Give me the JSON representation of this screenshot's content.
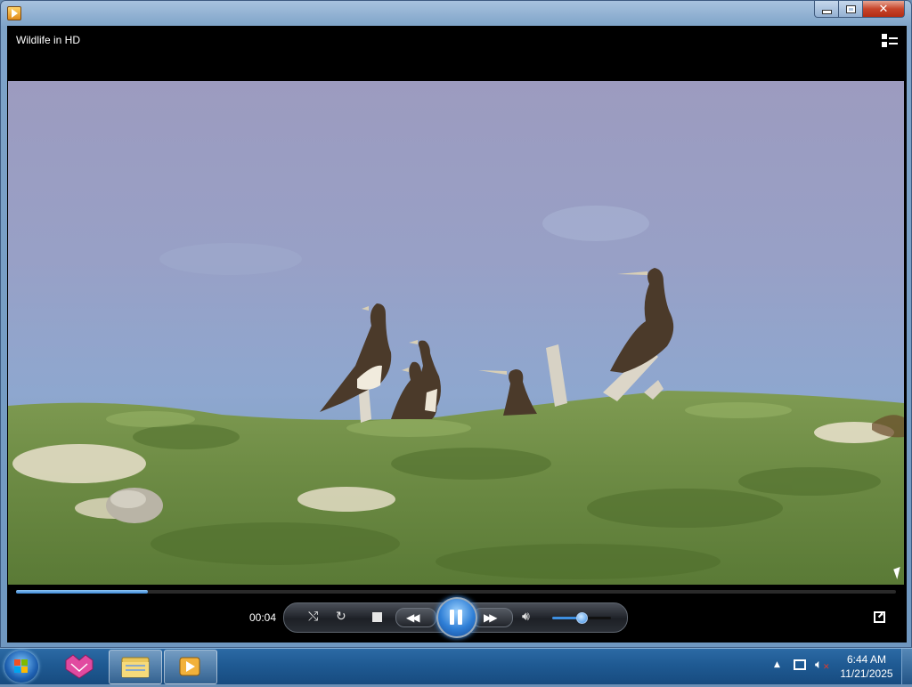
{
  "window": {
    "title": "",
    "now_playing": "Wildlife in HD"
  },
  "player": {
    "elapsed": "00:04",
    "seek_progress_fraction": 0.15,
    "volume_fraction": 0.5,
    "state": "playing"
  },
  "icons": {
    "app": "media-player-icon",
    "switch_to_library": "switch-to-library-icon",
    "shuffle": "shuffle-icon",
    "repeat": "repeat-icon",
    "stop": "stop-icon",
    "previous": "previous-icon",
    "pause": "pause-icon",
    "next": "next-icon",
    "volume": "speaker-icon",
    "fullscreen": "fullscreen-icon"
  },
  "taskbar": {
    "time": "6:44 AM",
    "date": "11/21/2025",
    "pinned": [
      "start-button",
      "paint-app",
      "file-explorer",
      "media-player"
    ]
  },
  "colors": {
    "accent": "#3b86d4",
    "taskbar": "#1f5a93"
  }
}
